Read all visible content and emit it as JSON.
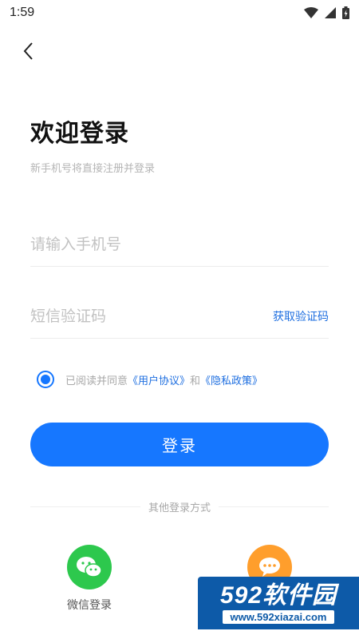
{
  "status_bar": {
    "time": "1:59"
  },
  "header": {
    "title": "欢迎登录",
    "subtitle": "新手机号将直接注册并登录"
  },
  "form": {
    "phone_placeholder": "请输入手机号",
    "code_placeholder": "短信验证码",
    "get_code_label": "获取验证码"
  },
  "agreement": {
    "checked": true,
    "prefix": "已阅读并同意",
    "user_agreement": "《用户协议》",
    "and": "和",
    "privacy_policy": "《隐私政策》"
  },
  "login_button": "登录",
  "other_login": {
    "divider_text": "其他登录方式",
    "wechat_label": "微信登录"
  },
  "watermark": {
    "brand": "592软件园",
    "url": "www.592xiazai.com"
  },
  "colors": {
    "primary": "#1677ff",
    "link": "#1f6fe0",
    "wechat": "#2dc84d",
    "other": "#ff9e2c"
  }
}
